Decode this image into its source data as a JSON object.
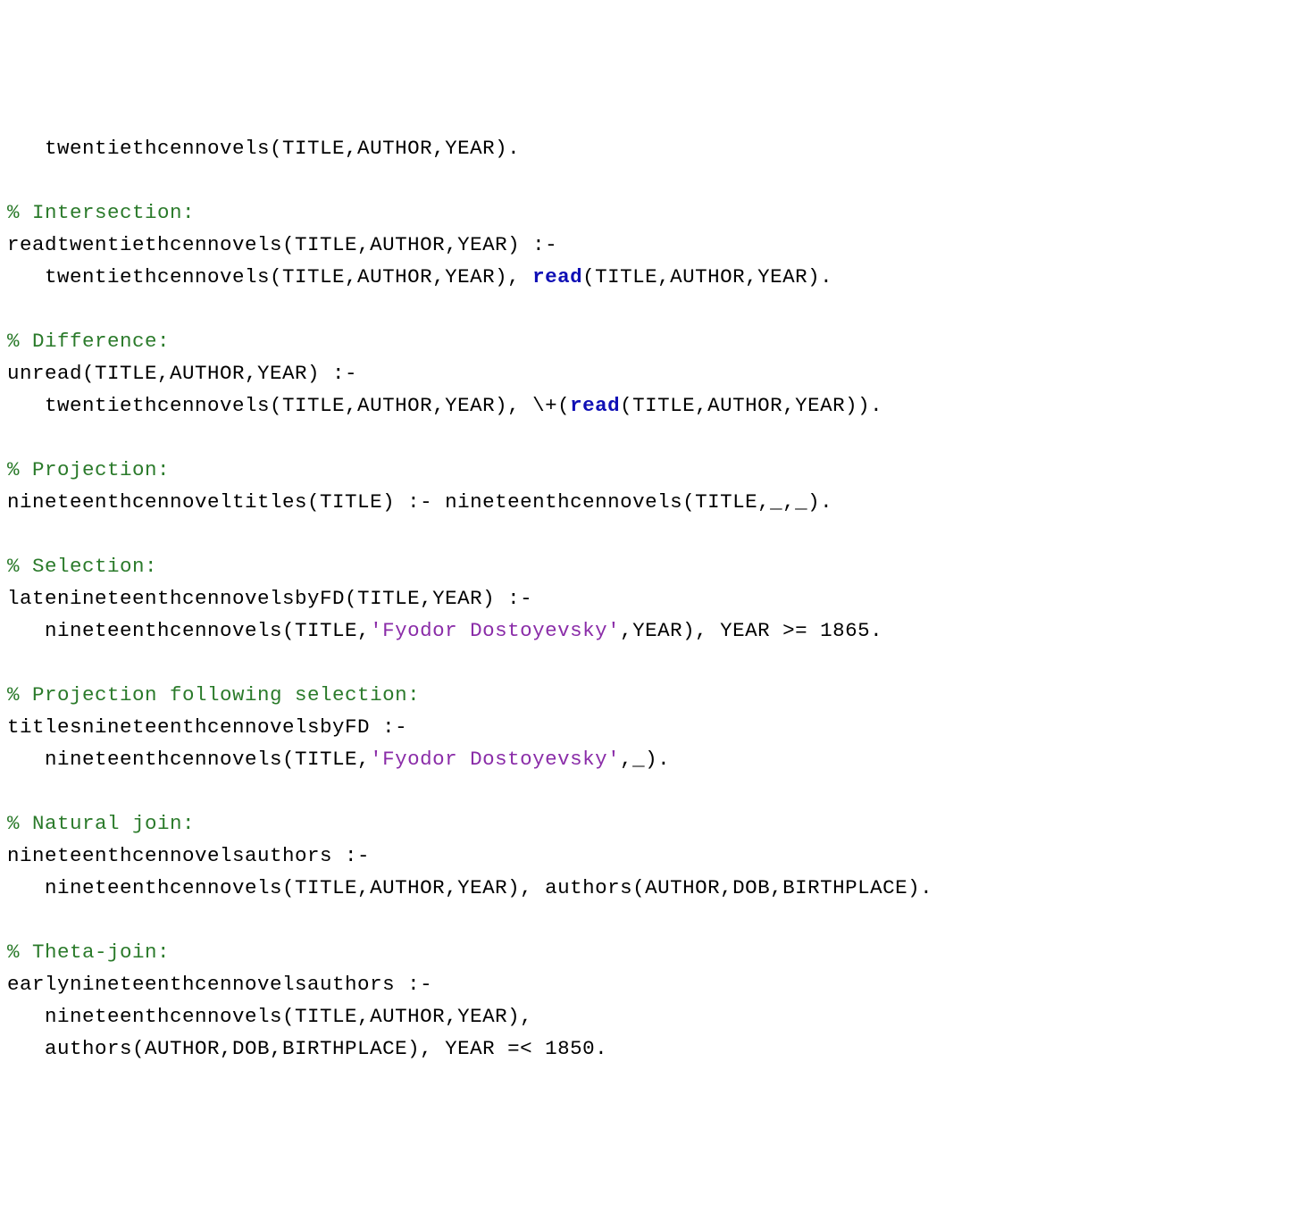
{
  "code": {
    "line01": "   twentiethcennovels(TITLE,AUTHOR,YEAR).",
    "line02": "",
    "line03": "% Intersection:",
    "line04a": "readtwentiethcennovels(TITLE,AUTHOR,YEAR) :-",
    "line05a": "   twentiethcennovels(TITLE,AUTHOR,YEAR), ",
    "line05b": "read",
    "line05c": "(TITLE,AUTHOR,YEAR).",
    "line06": "",
    "line07": "% Difference:",
    "line08": "unread(TITLE,AUTHOR,YEAR) :-",
    "line09a": "   twentiethcennovels(TITLE,AUTHOR,YEAR), \\+(",
    "line09b": "read",
    "line09c": "(TITLE,AUTHOR,YEAR)).",
    "line10": "",
    "line11": "% Projection:",
    "line12": "nineteenthcennoveltitles(TITLE) :- nineteenthcennovels(TITLE,_,_).",
    "line13": "",
    "line14": "% Selection:",
    "line15": "latenineteenthcennovelsbyFD(TITLE,YEAR) :-",
    "line16a": "   nineteenthcennovels(TITLE,",
    "line16b": "'Fyodor Dostoyevsky'",
    "line16c": ",YEAR), YEAR >= 1865.",
    "line17": "",
    "line18": "% Projection following selection:",
    "line19": "titlesnineteenthcennovelsbyFD :-",
    "line20a": "   nineteenthcennovels(TITLE,",
    "line20b": "'Fyodor Dostoyevsky'",
    "line20c": ",_).",
    "line21": "",
    "line22": "% Natural join:",
    "line23": "nineteenthcennovelsauthors :-",
    "line24": "   nineteenthcennovels(TITLE,AUTHOR,YEAR), authors(AUTHOR,DOB,BIRTHPLACE).",
    "line25": "",
    "line26": "% Theta-join:",
    "line27": "earlynineteenthcennovelsauthors :-",
    "line28": "   nineteenthcennovels(TITLE,AUTHOR,YEAR),",
    "line29": "   authors(AUTHOR,DOB,BIRTHPLACE), YEAR =< 1850."
  }
}
